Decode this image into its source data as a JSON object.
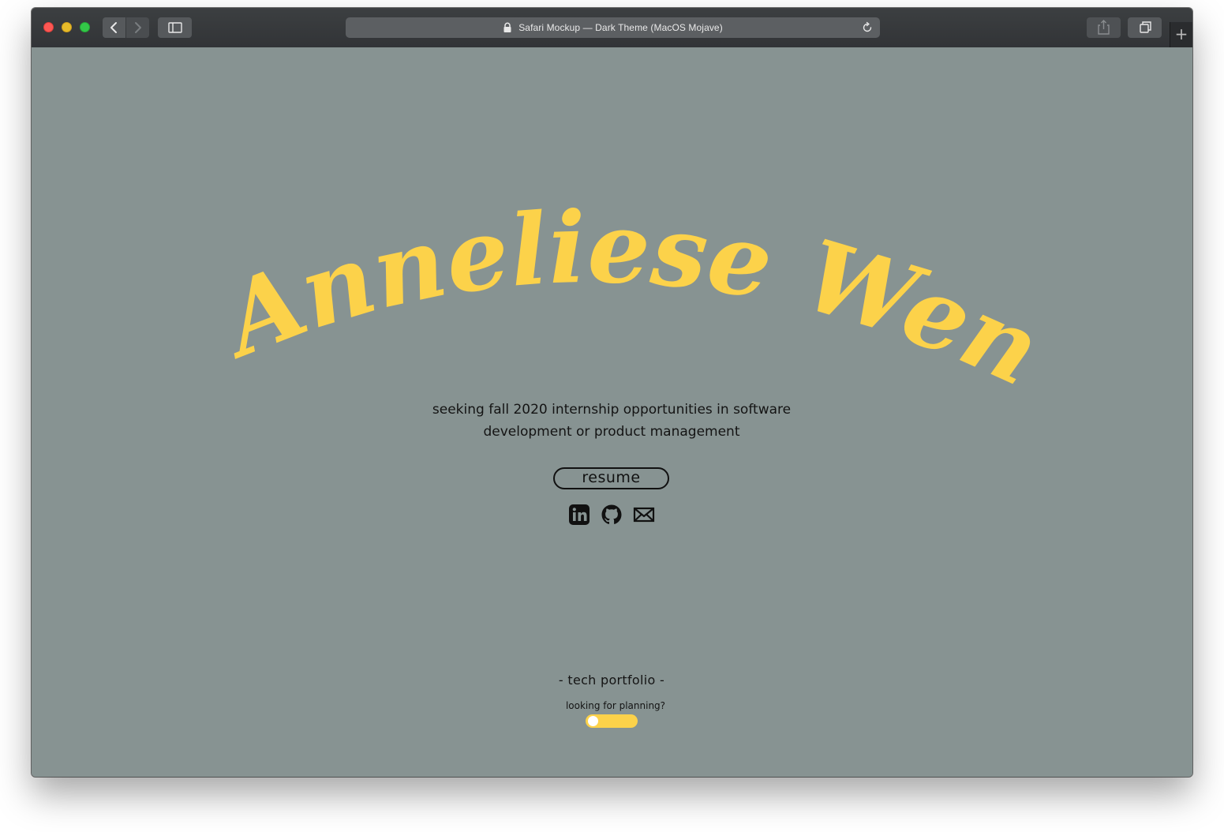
{
  "browser": {
    "title": "Safari Mockup — Dark Theme (MacOS Mojave)",
    "new_tab_glyph": "+",
    "traffic_lights": {
      "close": "#fc5753",
      "minimize": "#e6bb2a",
      "zoom": "#33c748"
    },
    "icons": [
      "lock-icon",
      "reload-icon",
      "share-icon",
      "tabs-icon",
      "sidebar-icon",
      "back-icon",
      "forward-icon"
    ]
  },
  "page": {
    "name": "Anneliese Wen",
    "name_color": "#fcd24a",
    "background_color": "#879392",
    "tagline_line1": "seeking fall 2020 internship opportunities in software",
    "tagline_line2": "development or product management",
    "resume_label": "resume",
    "social_icons": [
      "linkedin-icon",
      "github-icon",
      "email-icon"
    ],
    "footer_label": "- tech portfolio -",
    "toggle_label": "looking for planning?",
    "toggle_on": false,
    "toggle_color": "#fcd24a"
  }
}
